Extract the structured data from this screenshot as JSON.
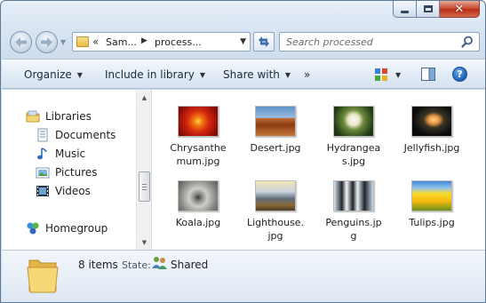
{
  "window": {
    "caption_buttons": {
      "minimize_icon": "minimize-icon",
      "maximize_icon": "maximize-icon",
      "close_glyph": "✕"
    }
  },
  "navigation": {
    "back_icon": "back-arrow-icon",
    "forward_icon": "forward-arrow-icon",
    "address": {
      "overflow": "«",
      "segments": [
        "Sam...",
        "process..."
      ]
    },
    "refresh_icon": "refresh-icon",
    "search": {
      "placeholder": "Search processed"
    }
  },
  "toolbar": {
    "organize": "Organize",
    "include_in_library": "Include in library",
    "share_with": "Share with",
    "more": "»",
    "help": "?"
  },
  "sidebar": {
    "libraries": "Libraries",
    "items": [
      "Documents",
      "Music",
      "Pictures",
      "Videos"
    ],
    "homegroup": "Homegroup"
  },
  "files": [
    {
      "name": "Chrysanthemum.jpg",
      "thumb": "chrysanthemum"
    },
    {
      "name": "Desert.jpg",
      "thumb": "desert"
    },
    {
      "name": "Hydrangeas.jpg",
      "thumb": "hydrangeas"
    },
    {
      "name": "Jellyfish.jpg",
      "thumb": "jellyfish"
    },
    {
      "name": "Koala.jpg",
      "thumb": "koala"
    },
    {
      "name": "Lighthouse.jpg",
      "thumb": "lighthouse"
    },
    {
      "name": "Penguins.jpg",
      "thumb": "penguins"
    },
    {
      "name": "Tulips.jpg",
      "thumb": "tulips"
    }
  ],
  "details": {
    "item_count": "8 items",
    "state_label": "State:",
    "state_value": "Shared"
  },
  "colors": {
    "window_frame": "#5f7893",
    "close_button": "#c9452c",
    "accent": "#3d6fb0"
  }
}
